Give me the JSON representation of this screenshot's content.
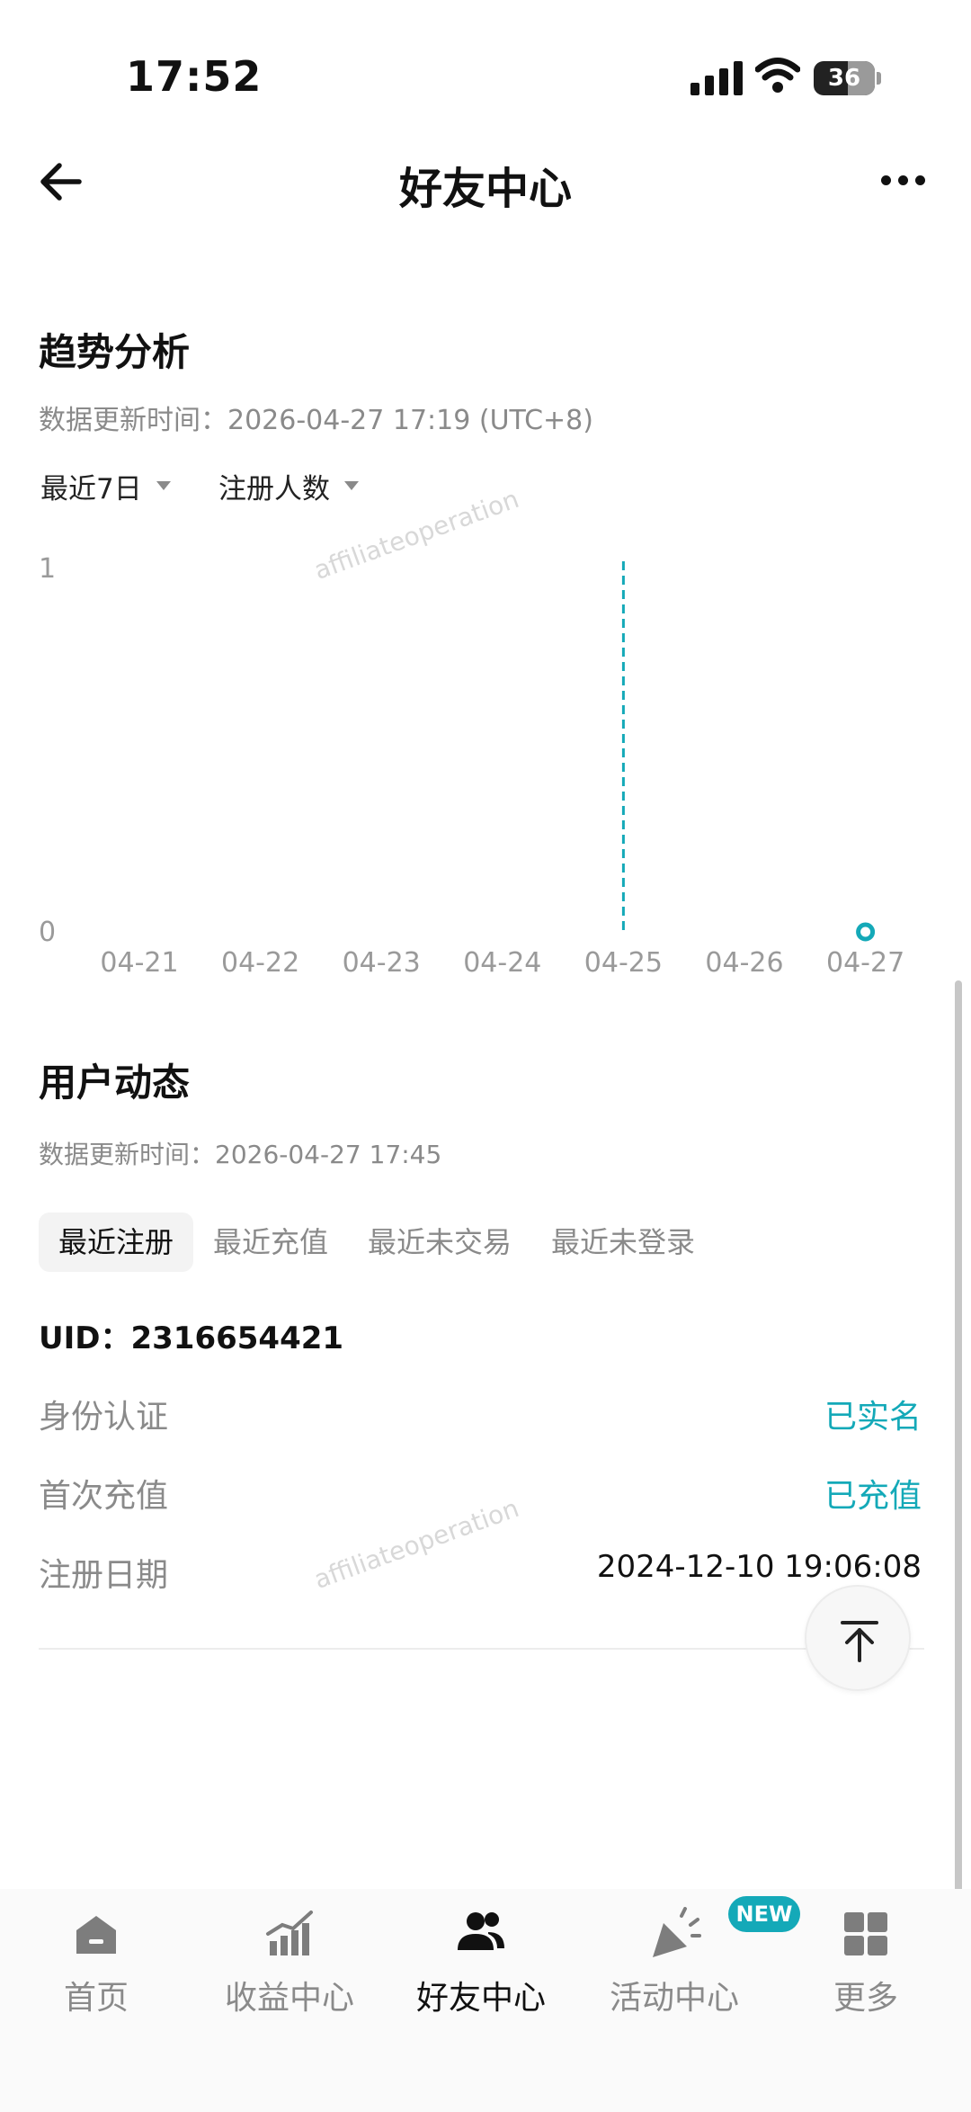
{
  "status_bar": {
    "time": "17:52",
    "battery": "36"
  },
  "nav": {
    "title": "好友中心"
  },
  "trend": {
    "title": "趋势分析",
    "update_time": "数据更新时间：2026-04-27 17:19 (UTC+8)",
    "range_dropdown": "最近7日",
    "metric_dropdown": "注册人数",
    "watermark": "affiliateoperation"
  },
  "chart_data": {
    "type": "line",
    "categories": [
      "04-21",
      "04-22",
      "04-23",
      "04-24",
      "04-25",
      "04-26",
      "04-27"
    ],
    "series": [
      {
        "values": [
          0,
          0,
          0,
          0,
          0,
          0,
          0
        ]
      }
    ],
    "y_ticks": [
      "0",
      "1"
    ],
    "ylim": [
      0,
      1
    ],
    "highlighted_category": "04-25",
    "colors": {
      "accent": "#14a9b8"
    }
  },
  "activity": {
    "title": "用户动态",
    "update_time": "数据更新时间：2026-04-27 17:45",
    "tabs": [
      {
        "label": "最近注册",
        "active": true
      },
      {
        "label": "最近充值",
        "active": false
      },
      {
        "label": "最近未交易",
        "active": false
      },
      {
        "label": "最近未登录",
        "active": false
      }
    ],
    "uid": "UID：2316654421",
    "rows": [
      {
        "label": "身份认证",
        "value": "已实名"
      },
      {
        "label": "首次充值",
        "value": "已充值"
      },
      {
        "label": "注册日期",
        "value": "2024-12-10 19:06:08"
      }
    ],
    "watermark": "affiliateoperation"
  },
  "tabbar": {
    "items": [
      {
        "label": "首页",
        "icon": "home-icon"
      },
      {
        "label": "收益中心",
        "icon": "earnings-chart-icon"
      },
      {
        "label": "好友中心",
        "icon": "friends-icon",
        "active": true
      },
      {
        "label": "活动中心",
        "icon": "party-popper-icon"
      },
      {
        "label": "更多",
        "icon": "grid-icon"
      }
    ],
    "new_badge": "NEW"
  }
}
